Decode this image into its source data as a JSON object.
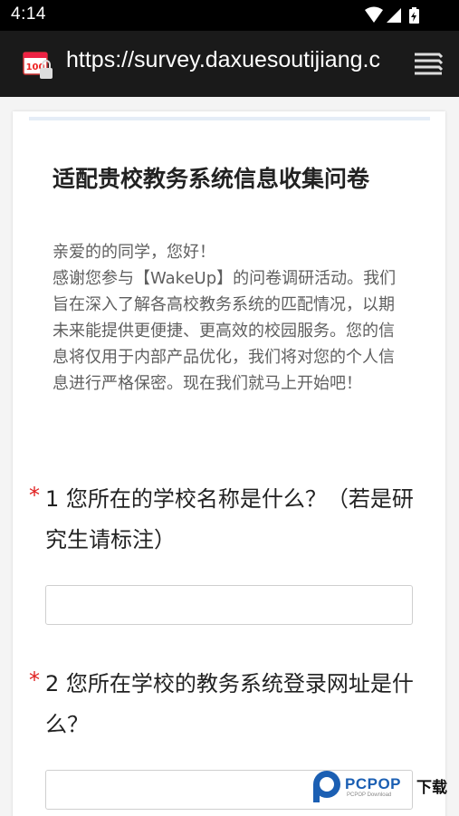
{
  "status_bar": {
    "time": "4:14",
    "icons": [
      "wifi-icon",
      "signal-icon",
      "battery-charging-icon"
    ]
  },
  "browser": {
    "url": "https://survey.daxuesoutijiang.c",
    "site_icon": "survey-site-icon",
    "menu_icon": "tabs-menu-icon"
  },
  "survey": {
    "title": "适配贵校教务系统信息收集问卷",
    "description": [
      "亲爱的的同学，您好！",
      "感谢您参与【WakeUp】的问卷调研活动。我们旨在深入了解各高校教务系统的匹配情况，以期未来能提供更便捷、更高效的校园服务。您的信息将仅用于内部产品优化，我们将对您的个人信息进行严格保密。现在我们就马上开始吧！"
    ],
    "questions": [
      {
        "required_mark": "*",
        "text": "1  您所在的学校名称是什么？（若是研究生请标注）",
        "answer": ""
      },
      {
        "required_mark": "*",
        "text": "2  您所在学校的教务系统登录网址是什么？",
        "answer": ""
      }
    ]
  },
  "watermark": {
    "brand": "PCPOP",
    "cn": "下载",
    "sub": "PCPOP Download"
  },
  "colors": {
    "status_bg": "#000000",
    "urlbar_bg": "#1a1a1a",
    "required": "#e02020",
    "watermark_blue": "#1b5fb3"
  }
}
